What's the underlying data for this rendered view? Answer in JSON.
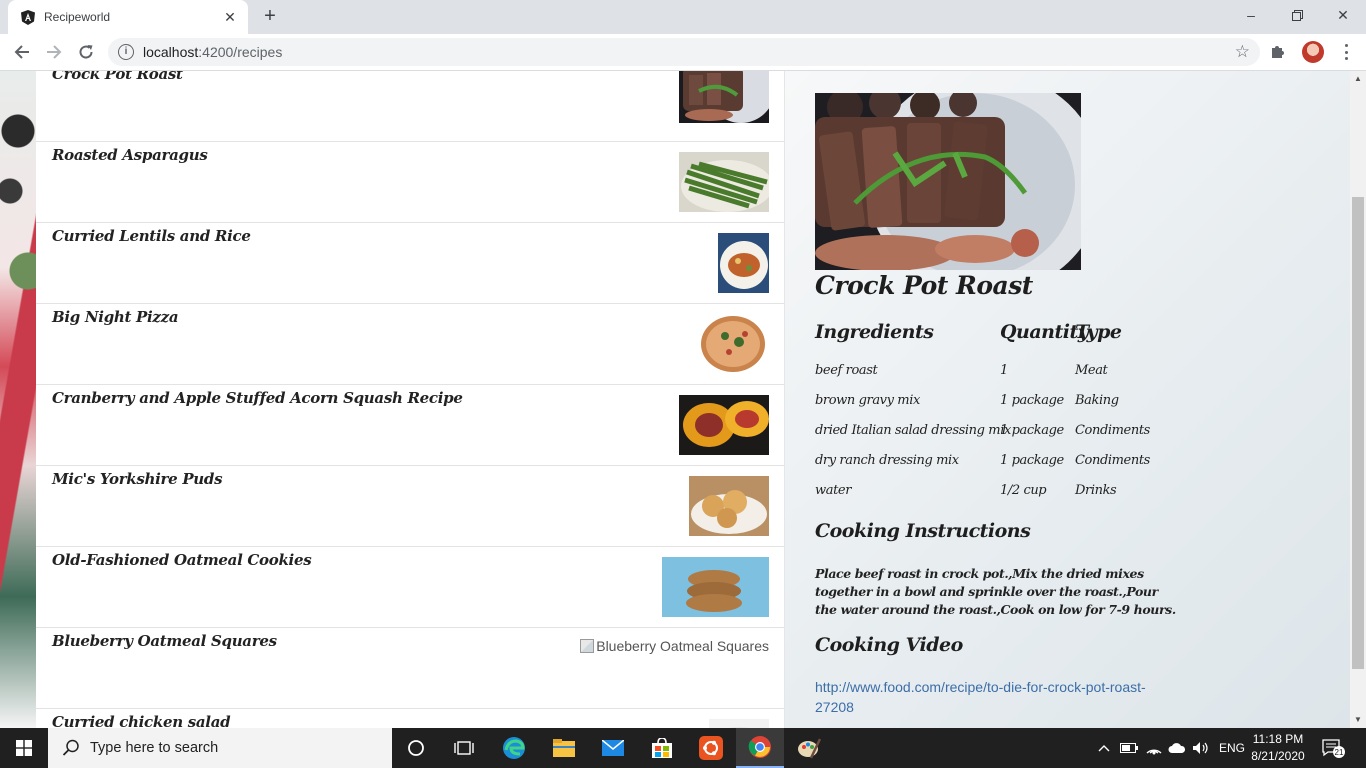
{
  "browser": {
    "tab_title": "Recipeworld",
    "url_host": "localhost",
    "url_rest": ":4200/recipes"
  },
  "recipes": [
    "Crock Pot Roast",
    "Roasted Asparagus",
    "Curried Lentils and Rice",
    "Big Night Pizza",
    "Cranberry and Apple Stuffed Acorn Squash Recipe",
    "Mic's Yorkshire Puds",
    "Old-Fashioned Oatmeal Cookies",
    "Blueberry Oatmeal Squares",
    "Curried chicken salad"
  ],
  "broken_image_alt": "Blueberry Oatmeal Squares",
  "detail": {
    "title": "Crock Pot Roast",
    "headers": {
      "ingredients": "Ingredients",
      "quantity": "Quantity",
      "type": "Type"
    },
    "ingredients": [
      {
        "name": "beef roast",
        "quantity": "1",
        "type": "Meat"
      },
      {
        "name": "brown gravy mix",
        "quantity": "1 package",
        "type": "Baking"
      },
      {
        "name": "dried Italian salad dressing mix",
        "quantity": "1 package",
        "type": "Condiments"
      },
      {
        "name": "dry ranch dressing mix",
        "quantity": "1 package",
        "type": "Condiments"
      },
      {
        "name": "water",
        "quantity": "1/2 cup",
        "type": "Drinks"
      }
    ],
    "instructions_heading": "Cooking Instructions",
    "instructions": "Place beef roast in crock pot.,Mix the dried mixes together in a bowl and sprinkle over the roast.,Pour the water around the roast.,Cook on low for 7-9 hours.",
    "video_heading": "Cooking Video",
    "video_url": "http://www.food.com/recipe/to-die-for-crock-pot-roast-27208"
  },
  "taskbar": {
    "search_placeholder": "Type here to search",
    "language": "ENG",
    "time": "11:18 PM",
    "date": "8/21/2020",
    "notification_count": "21"
  },
  "colors": {
    "link": "#3c6ea8",
    "taskbar": "#202020",
    "tab_strip": "#dee1e6"
  }
}
